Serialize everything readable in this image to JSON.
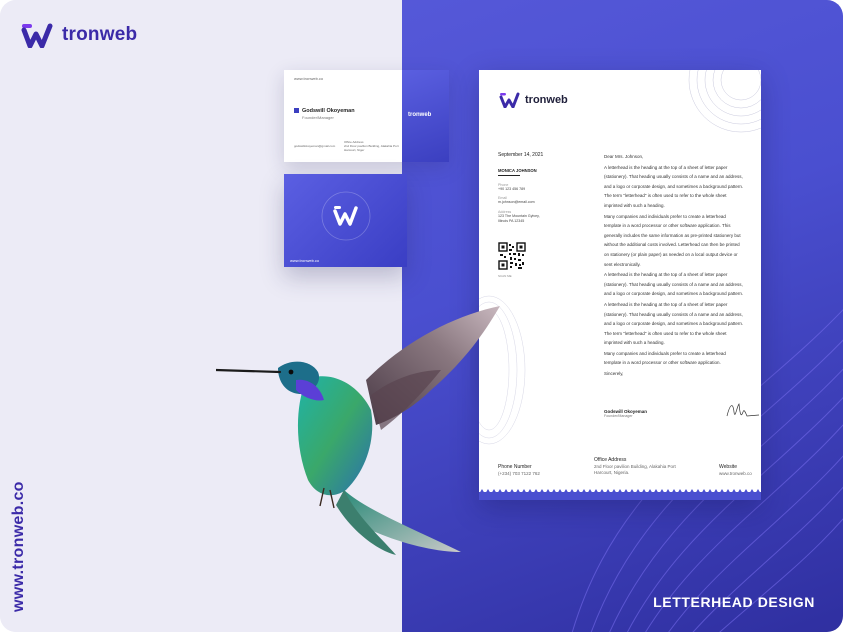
{
  "brand": {
    "name": "tronweb"
  },
  "vertical_url": "www.tronweb.co",
  "design_title": "LETTERHEAD DESIGN",
  "business_card": {
    "front": {
      "url": "www.tronweb.co",
      "name": "Godswill Okoyeman",
      "role": "Founder/Manager",
      "email": "godswillokoyeman@gmail.com",
      "office_label": "Office Address",
      "office_address": "2nd Floor pavilion Building, Alakahia Port Harcourt, Niger",
      "logo_text": "tronweb"
    },
    "back": {
      "url": "www.tronweb.co"
    }
  },
  "letterhead": {
    "logo_text": "tronweb",
    "date": "September 14, 2021",
    "recipient": "MONICA JOHNSON",
    "phone_label": "Phone",
    "phone_value": "+90 123 456 789",
    "email_label": "Email",
    "email_value": "m.johnson@email.com",
    "address_label": "Address",
    "address_value": "123 The Mountain Gylvey, Illinois PA 12345",
    "qr_caption": "SCAN ME",
    "greeting": "Dear Mrs. Johnson,",
    "paragraphs": [
      "A letterhead is the heading at the top of a sheet of letter paper (stationery). That heading usually consists of a name and an address, and a logo or corporate design, and sometimes a background pattern. The term \"letterhead\" is often used to refer to the whole sheet imprinted with such a heading.",
      "Many companies and individuals prefer to create a letterhead template in a word processor or other software application. This generally includes the same information as pre-printed stationery but without the additional costs involved. Letterhead can then be printed on stationery (or plain paper) as needed on a local output device or sent electronically.",
      "A letterhead is the heading at the top of a sheet of letter paper (stationery). That heading usually consists of a name and an address, and a logo or corporate design, and sometimes a background pattern.",
      "A letterhead is the heading at the top of a sheet of letter paper (stationery). That heading usually consists of a name and an address, and a logo or corporate design, and sometimes a background pattern. The term \"letterhead\" is often used to refer to the whole sheet imprinted with such a heading.",
      "Many companies and individuals prefer to create a letterhead template in a word processor or other software application."
    ],
    "closing": "Sincerely,",
    "signer_name": "Godswill Okoyeman",
    "signer_role": "Founder/Manager",
    "footer": {
      "phone_label": "Phone Number",
      "phone_value": "(+234) 703 7122 762",
      "office_label": "Office Address",
      "office_value": "2nd Floor pavilion Building, Alakahia Port Harcourt, Nigeria.",
      "website_label": "Website",
      "website_value": "www.tronweb.co"
    }
  },
  "colors": {
    "brand": "#3b2aa8",
    "accent": "#4a4fd0",
    "background_left": "#ecebf6"
  }
}
